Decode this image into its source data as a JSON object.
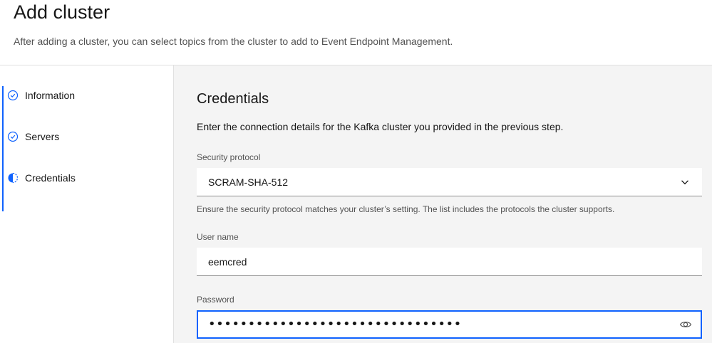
{
  "header": {
    "title": "Add cluster",
    "description": "After adding a cluster, you can select topics from the cluster to add to Event Endpoint Management."
  },
  "sidebar": {
    "steps": [
      {
        "label": "Information",
        "state": "complete",
        "icon": "checkmark-outline-icon"
      },
      {
        "label": "Servers",
        "state": "complete",
        "icon": "checkmark-outline-icon"
      },
      {
        "label": "Credentials",
        "state": "current",
        "icon": "incomplete-icon"
      }
    ]
  },
  "main": {
    "section_title": "Credentials",
    "section_description": "Enter the connection details for the Kafka cluster you provided in the previous step.",
    "security_protocol": {
      "label": "Security protocol",
      "value": "SCRAM-SHA-512",
      "helper": "Ensure the security protocol matches your cluster’s setting. The list includes the protocols the cluster supports."
    },
    "username": {
      "label": "User name",
      "value": "eemcred"
    },
    "password": {
      "label": "Password",
      "masked_value": "••••••••••••••••••••••••••••••••",
      "toggle_icon": "view-icon"
    }
  },
  "colors": {
    "accent": "#0f62fe",
    "panel_background": "#f4f4f4",
    "text_primary": "#161616",
    "text_secondary": "#525252"
  }
}
